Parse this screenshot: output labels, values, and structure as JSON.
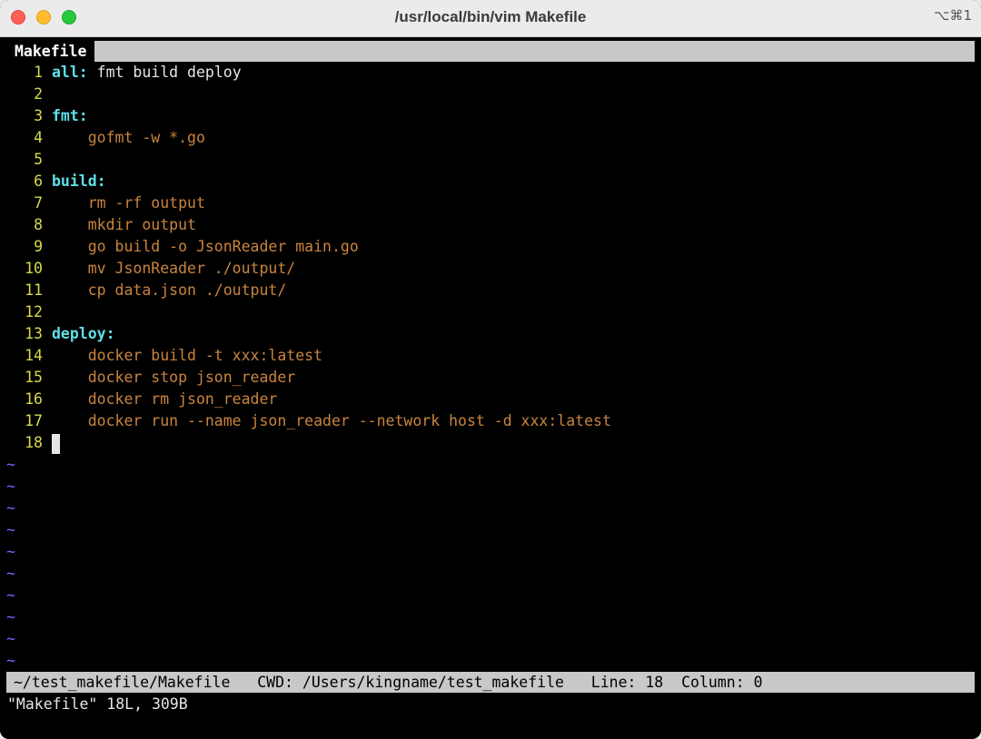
{
  "window": {
    "title": "/usr/local/bin/vim Makefile",
    "shortcut": "⌥⌘1",
    "buttons": {
      "close": "×",
      "minimize": "−",
      "zoom": "+"
    }
  },
  "colors": {
    "target": "#5fe0e8",
    "recipe": "#c9843e",
    "line_number": "#d9d94c",
    "tilde": "#6b6bff",
    "status_bg": "#c8c8c8"
  },
  "tabline": {
    "active_tab": "Makefile"
  },
  "editor": {
    "lines": [
      {
        "num": "1",
        "target": "all:",
        "text": " fmt build deploy"
      },
      {
        "num": "2",
        "text": ""
      },
      {
        "num": "3",
        "target": "fmt:",
        "text": ""
      },
      {
        "num": "4",
        "recipe": "    gofmt -w *.go"
      },
      {
        "num": "5",
        "text": ""
      },
      {
        "num": "6",
        "target": "build:",
        "text": ""
      },
      {
        "num": "7",
        "recipe": "    rm -rf output"
      },
      {
        "num": "8",
        "recipe": "    mkdir output"
      },
      {
        "num": "9",
        "recipe": "    go build -o JsonReader main.go"
      },
      {
        "num": "10",
        "recipe": "    mv JsonReader ./output/"
      },
      {
        "num": "11",
        "recipe": "    cp data.json ./output/"
      },
      {
        "num": "12",
        "text": ""
      },
      {
        "num": "13",
        "target": "deploy:",
        "text": ""
      },
      {
        "num": "14",
        "recipe": "    docker build -t xxx:latest"
      },
      {
        "num": "15",
        "recipe": "    docker stop json_reader"
      },
      {
        "num": "16",
        "recipe": "    docker rm json_reader"
      },
      {
        "num": "17",
        "recipe": "    docker run --name json_reader --network host -d xxx:latest"
      },
      {
        "num": "18",
        "text": ""
      }
    ],
    "tilde": "~",
    "tilde_count": 10
  },
  "statusline": {
    "text": "~/test_makefile/Makefile   CWD: /Users/kingname/test_makefile   Line: 18  Column: 0"
  },
  "message": "\"Makefile\" 18L, 309B"
}
